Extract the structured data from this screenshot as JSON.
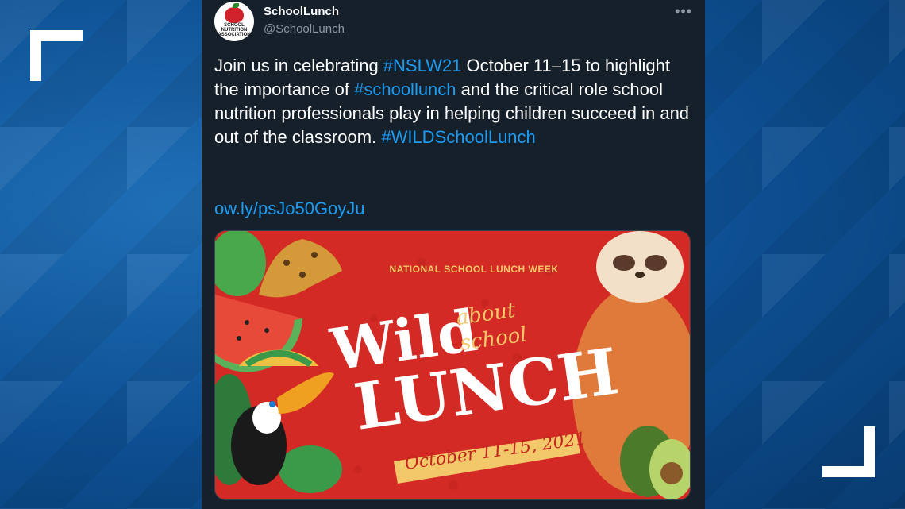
{
  "background": {
    "primary_color": "#0d4f92"
  },
  "tweet": {
    "account_name": "SchoolLunch",
    "handle": "@SchoolLunch",
    "avatar_text_1": "SCHOOL",
    "avatar_text_2": "NUTRITION",
    "avatar_text_3": "ASSOCIATION",
    "more_icon": "more-options-icon",
    "text_1": "Join us in celebrating ",
    "tag_1": "#NSLW21",
    "text_2": " October 11–15 to highlight the importance of ",
    "tag_2": "#schoollunch",
    "text_3": " and the critical role school nutrition professionals play in helping children succeed in and out of the classroom. ",
    "tag_3": "#WILDSchoolLunch",
    "link": "ow.ly/psJo50GoyJu",
    "link_color": "#1d9bf0"
  },
  "media": {
    "header": "NATIONAL SCHOOL LUNCH WEEK",
    "title_word_1": "Wild",
    "title_about": "about",
    "title_school": "school",
    "title_word_2": "LUNCH",
    "dates": "October 11-15, 2021",
    "background_color": "#d42a25",
    "accent_color": "#f3c86a"
  }
}
